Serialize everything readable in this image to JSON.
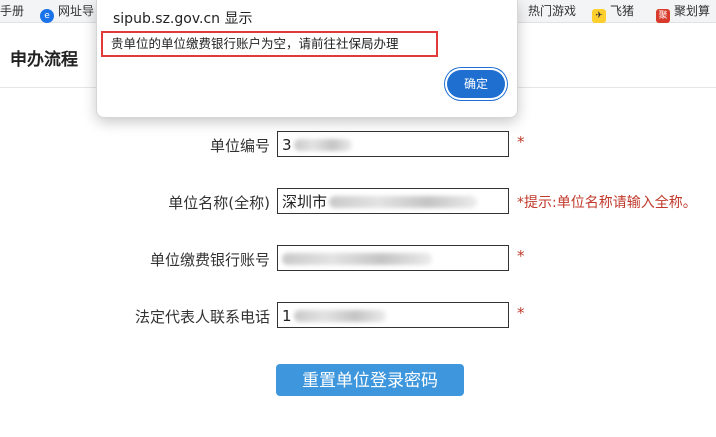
{
  "bookmarks": {
    "items": [
      {
        "label": "手册"
      },
      {
        "label": "网址导"
      },
      {
        "label": "热门游戏"
      },
      {
        "label": "飞猪"
      },
      {
        "label": "聚划算"
      }
    ]
  },
  "page": {
    "title": "申办流程"
  },
  "form": {
    "fields": [
      {
        "label": "单位编号",
        "value_visible": "3",
        "required_mark": "*"
      },
      {
        "label": "单位名称(全称)",
        "value_visible": "深圳市",
        "hint": "*提示:单位名称请输入全称。"
      },
      {
        "label": "单位缴费银行账号",
        "value_visible": "",
        "required_mark": "*"
      },
      {
        "label": "法定代表人联系电话",
        "value_visible": "1",
        "required_mark": "*"
      }
    ],
    "submit_label": "重置单位登录密码"
  },
  "dialog": {
    "origin": "sipub.sz.gov.cn 显示",
    "message": "贵单位的单位缴费银行账户为空，请前往社保局办理",
    "ok_label": "确定"
  },
  "colors": {
    "submit_button": "#3e97dc",
    "required_red": "#c0392b",
    "dialog_highlight": "#e23a3a",
    "dialog_ok": "#1f6fd0"
  }
}
